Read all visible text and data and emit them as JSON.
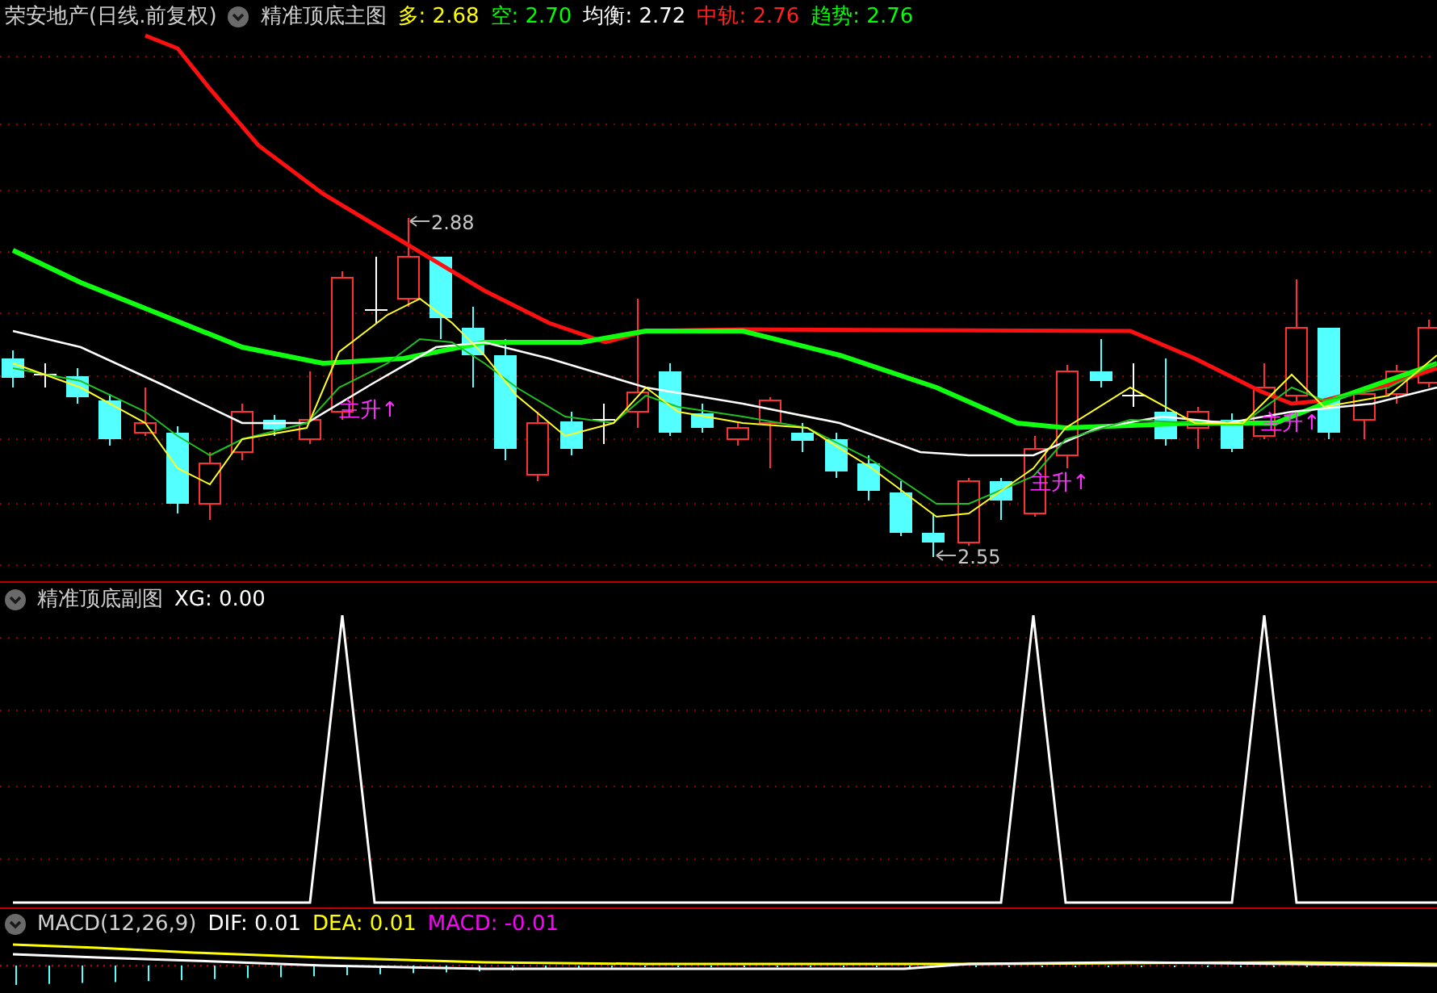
{
  "main_panel": {
    "title": "荣安地产(日线.前复权)",
    "indicator": "精准顶底主图",
    "readings": [
      {
        "text": "多: 2.68",
        "color": "#ffff00"
      },
      {
        "text": "空: 2.70",
        "color": "#00ff00"
      },
      {
        "text": "均衡: 2.72",
        "color": "#ffffff"
      },
      {
        "text": "中轨: 2.76",
        "color": "#ff2020"
      },
      {
        "text": "趋势: 2.76",
        "color": "#00ff00"
      }
    ],
    "high_label": "2.88",
    "low_label": "2.55",
    "signals": [
      "主升↑",
      "主升↑",
      "主升↑"
    ]
  },
  "sub_panel": {
    "indicator": "精准顶底副图",
    "readings": [
      {
        "text": "XG: 0.00",
        "color": "#ffffff"
      }
    ]
  },
  "macd_panel": {
    "indicator": "MACD(12,26,9)",
    "readings": [
      {
        "text": "DIF: 0.01",
        "color": "#ffffff"
      },
      {
        "text": "DEA: 0.01",
        "color": "#ffff00"
      },
      {
        "text": "MACD: -0.01",
        "color": "#ff00ff"
      }
    ]
  }
}
